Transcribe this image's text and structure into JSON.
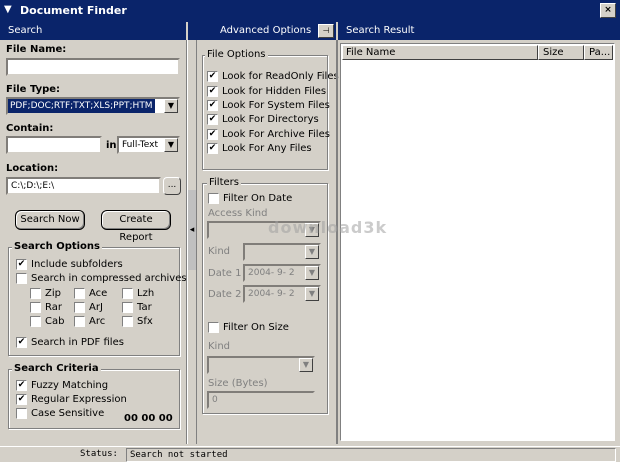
{
  "window": {
    "title": "Document Finder",
    "close_glyph": "×"
  },
  "panels": {
    "search": "Search",
    "advanced": "Advanced Options",
    "result": "Search Result"
  },
  "search": {
    "file_name_label": "File Name:",
    "file_name_value": "",
    "file_type_label": "File Type:",
    "file_type_value": "PDF;DOC;RTF;TXT;XLS;PPT;HTM",
    "contain_label": "Contain:",
    "contain_value": "",
    "in_label": "in",
    "in_value": "Full-Text",
    "location_label": "Location:",
    "location_value": "C:\\;D:\\;E:\\",
    "browse_label": "...",
    "search_now": "Search Now",
    "create_report": "Create Report"
  },
  "search_options": {
    "title": "Search Options",
    "include_subfolders": "Include subfolders",
    "compressed": "Search in compressed archives",
    "archives": [
      "Zip",
      "Ace",
      "Lzh",
      "Rar",
      "ArJ",
      "Tar",
      "Cab",
      "Arc",
      "Sfx"
    ],
    "pdf": "Search in PDF files"
  },
  "search_criteria": {
    "title": "Search Criteria",
    "fuzzy": "Fuzzy Matching",
    "regex": "Regular Expression",
    "case": "Case Sensitive",
    "timer": "00 00 00"
  },
  "file_options": {
    "title": "File Options",
    "items": [
      "Look for ReadOnly Files",
      "Look for Hidden Files",
      "Look For System Files",
      "Look For Directorys",
      "Look For Archive Files",
      "Look For Any Files"
    ]
  },
  "filters": {
    "title": "Filters",
    "filter_on_date": "Filter On Date",
    "access_kind": "Access Kind",
    "kind": "Kind",
    "date1": "Date 1",
    "date1_value": "2004-  9-  2",
    "date2": "Date 2",
    "date2_value": "2004-  9-  2",
    "filter_on_size": "Filter On Size",
    "kind2": "Kind",
    "size_label": "Size (Bytes)",
    "size_value": "0"
  },
  "results": {
    "columns": [
      "File Name",
      "Size",
      "Pa..."
    ]
  },
  "watermark": "download3k",
  "status": {
    "label": "Status:",
    "value": "Search not started"
  }
}
